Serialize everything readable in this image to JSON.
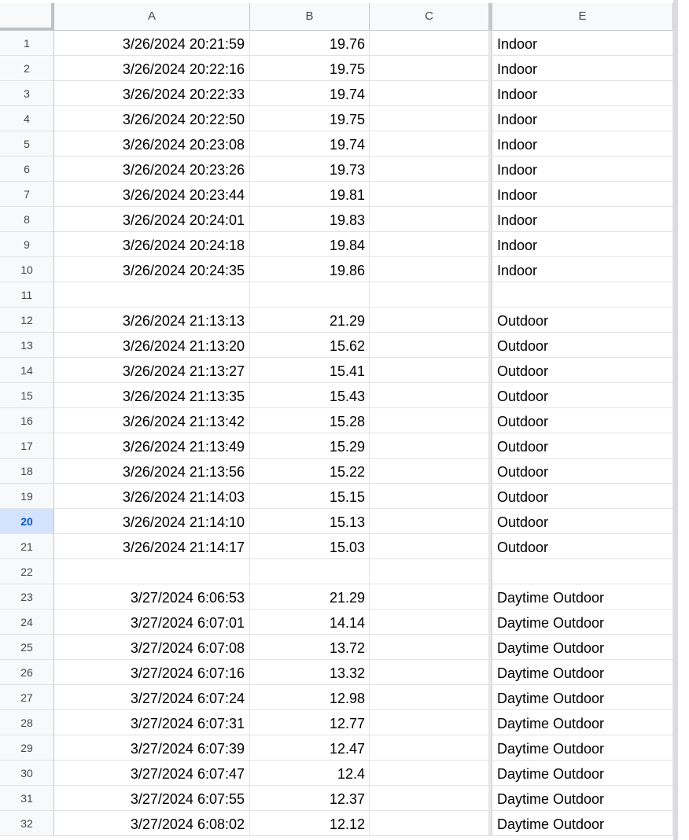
{
  "columns": {
    "a": "A",
    "b": "B",
    "c": "C",
    "e": "E"
  },
  "rows": [
    {
      "num": "1",
      "a": "3/26/2024 20:21:59",
      "b": "19.76",
      "c": "",
      "e": "Indoor"
    },
    {
      "num": "2",
      "a": "3/26/2024 20:22:16",
      "b": "19.75",
      "c": "",
      "e": "Indoor"
    },
    {
      "num": "3",
      "a": "3/26/2024 20:22:33",
      "b": "19.74",
      "c": "",
      "e": "Indoor"
    },
    {
      "num": "4",
      "a": "3/26/2024 20:22:50",
      "b": "19.75",
      "c": "",
      "e": "Indoor"
    },
    {
      "num": "5",
      "a": "3/26/2024 20:23:08",
      "b": "19.74",
      "c": "",
      "e": "Indoor"
    },
    {
      "num": "6",
      "a": "3/26/2024 20:23:26",
      "b": "19.73",
      "c": "",
      "e": "Indoor"
    },
    {
      "num": "7",
      "a": "3/26/2024 20:23:44",
      "b": "19.81",
      "c": "",
      "e": "Indoor"
    },
    {
      "num": "8",
      "a": "3/26/2024 20:24:01",
      "b": "19.83",
      "c": "",
      "e": "Indoor"
    },
    {
      "num": "9",
      "a": "3/26/2024 20:24:18",
      "b": "19.84",
      "c": "",
      "e": "Indoor"
    },
    {
      "num": "10",
      "a": "3/26/2024 20:24:35",
      "b": "19.86",
      "c": "",
      "e": "Indoor"
    },
    {
      "num": "11",
      "a": "",
      "b": "",
      "c": "",
      "e": ""
    },
    {
      "num": "12",
      "a": "3/26/2024 21:13:13",
      "b": "21.29",
      "c": "",
      "e": "Outdoor"
    },
    {
      "num": "13",
      "a": "3/26/2024 21:13:20",
      "b": "15.62",
      "c": "",
      "e": "Outdoor"
    },
    {
      "num": "14",
      "a": "3/26/2024 21:13:27",
      "b": "15.41",
      "c": "",
      "e": "Outdoor"
    },
    {
      "num": "15",
      "a": "3/26/2024 21:13:35",
      "b": "15.43",
      "c": "",
      "e": "Outdoor"
    },
    {
      "num": "16",
      "a": "3/26/2024 21:13:42",
      "b": "15.28",
      "c": "",
      "e": "Outdoor"
    },
    {
      "num": "17",
      "a": "3/26/2024 21:13:49",
      "b": "15.29",
      "c": "",
      "e": "Outdoor"
    },
    {
      "num": "18",
      "a": "3/26/2024 21:13:56",
      "b": "15.22",
      "c": "",
      "e": "Outdoor"
    },
    {
      "num": "19",
      "a": "3/26/2024 21:14:03",
      "b": "15.15",
      "c": "",
      "e": "Outdoor"
    },
    {
      "num": "20",
      "a": "3/26/2024 21:14:10",
      "b": "15.13",
      "c": "",
      "e": "Outdoor",
      "selected": true
    },
    {
      "num": "21",
      "a": "3/26/2024 21:14:17",
      "b": "15.03",
      "c": "",
      "e": "Outdoor"
    },
    {
      "num": "22",
      "a": "",
      "b": "",
      "c": "",
      "e": ""
    },
    {
      "num": "23",
      "a": "3/27/2024 6:06:53",
      "b": "21.29",
      "c": "",
      "e": "Daytime Outdoor"
    },
    {
      "num": "24",
      "a": "3/27/2024 6:07:01",
      "b": "14.14",
      "c": "",
      "e": "Daytime Outdoor"
    },
    {
      "num": "25",
      "a": "3/27/2024 6:07:08",
      "b": "13.72",
      "c": "",
      "e": "Daytime Outdoor"
    },
    {
      "num": "26",
      "a": "3/27/2024 6:07:16",
      "b": "13.32",
      "c": "",
      "e": "Daytime Outdoor"
    },
    {
      "num": "27",
      "a": "3/27/2024 6:07:24",
      "b": "12.98",
      "c": "",
      "e": "Daytime Outdoor"
    },
    {
      "num": "28",
      "a": "3/27/2024 6:07:31",
      "b": "12.77",
      "c": "",
      "e": "Daytime Outdoor"
    },
    {
      "num": "29",
      "a": "3/27/2024 6:07:39",
      "b": "12.47",
      "c": "",
      "e": "Daytime Outdoor"
    },
    {
      "num": "30",
      "a": "3/27/2024 6:07:47",
      "b": "12.4",
      "c": "",
      "e": "Daytime Outdoor"
    },
    {
      "num": "31",
      "a": "3/27/2024 6:07:55",
      "b": "12.37",
      "c": "",
      "e": "Daytime Outdoor"
    },
    {
      "num": "32",
      "a": "3/27/2024 6:08:02",
      "b": "12.12",
      "c": "",
      "e": "Daytime Outdoor"
    }
  ],
  "colors": {
    "header_bg": "#f8f9fa",
    "gridline": "#e2e3e3",
    "selected_row_bg": "#d3e3fd",
    "selected_row_text": "#0b57d0"
  }
}
